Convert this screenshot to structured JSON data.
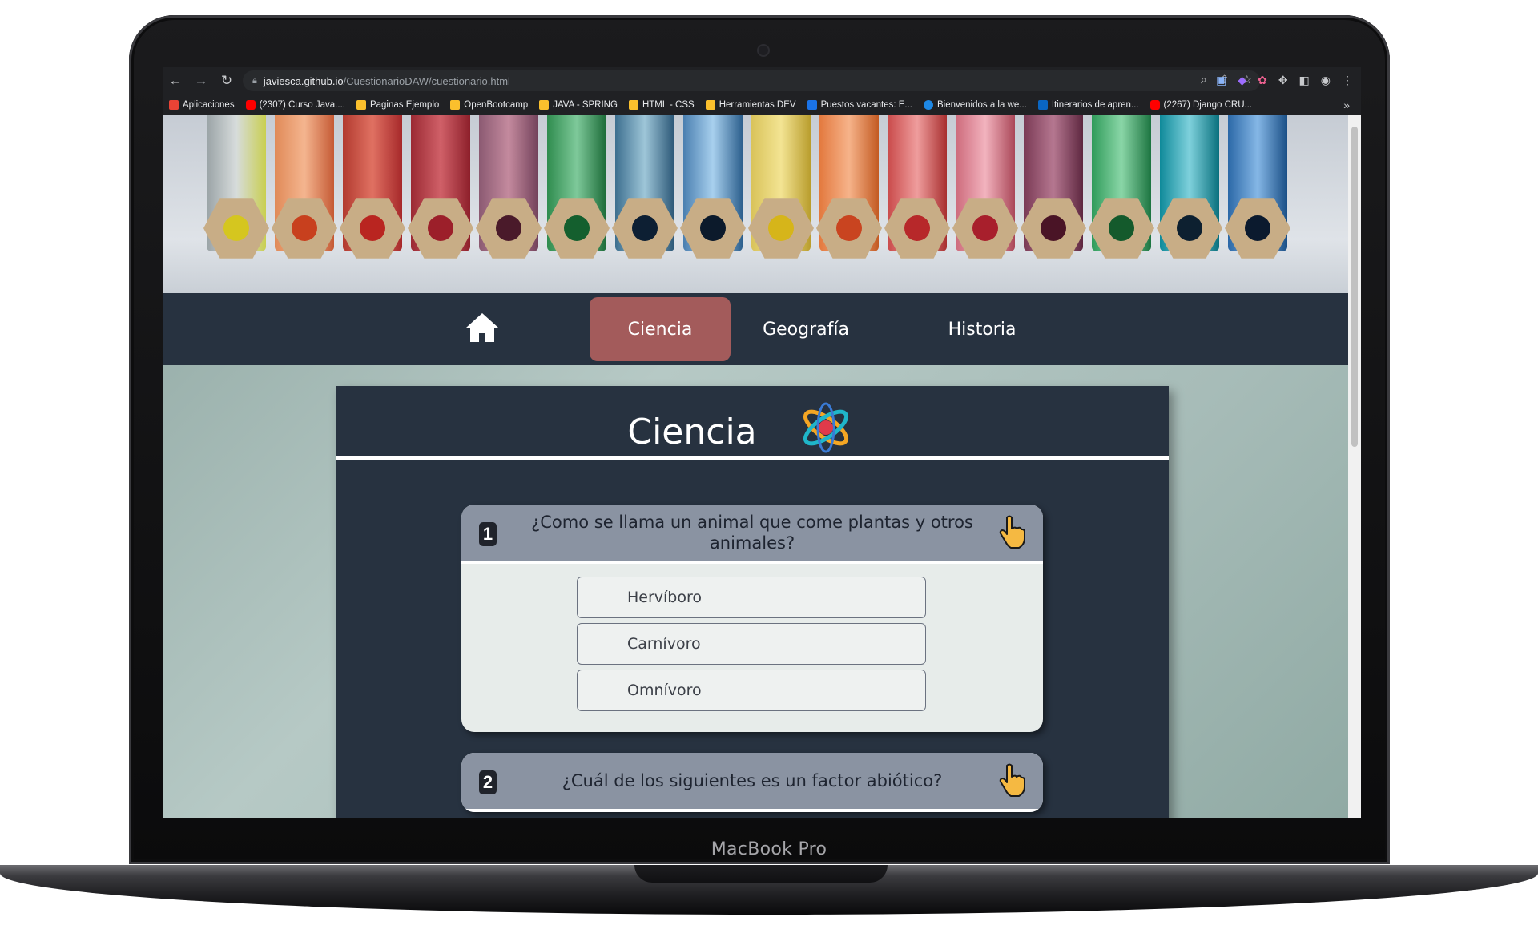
{
  "browser": {
    "url_host": "javiesca.github.io",
    "url_path": "/CuestionarioDAW/cuestionario.html",
    "bookmarks": [
      {
        "label": "Aplicaciones",
        "color": "#ea4335"
      },
      {
        "label": "(2307) Curso Java....",
        "color": "#ff0000"
      },
      {
        "label": "Paginas Ejemplo",
        "color": "#fbc02d"
      },
      {
        "label": "OpenBootcamp",
        "color": "#fbc02d"
      },
      {
        "label": "JAVA - SPRING",
        "color": "#fbc02d"
      },
      {
        "label": "HTML - CSS",
        "color": "#fbc02d"
      },
      {
        "label": "Herramientas DEV",
        "color": "#fbc02d"
      },
      {
        "label": "Puestos vacantes: E...",
        "color": "#1a73e8"
      },
      {
        "label": "Bienvenidos a la we...",
        "color": "#1e88e5"
      },
      {
        "label": "Itinerarios de apren...",
        "color": "#0a66c2"
      },
      {
        "label": "(2267) Django CRU...",
        "color": "#ff0000"
      }
    ],
    "more": "»"
  },
  "nav": {
    "items": [
      "Ciencia",
      "Geografía",
      "Historia"
    ],
    "active": "Ciencia",
    "active_color": "#a35b5b"
  },
  "section": {
    "title": "Ciencia"
  },
  "questions": [
    {
      "number": "1",
      "text": "¿Como se llama un animal que come plantas y otros animales?",
      "answers": [
        "Hervíboro",
        "Carnívoro",
        "Omnívoro"
      ]
    },
    {
      "number": "2",
      "text": "¿Cuál de los siguientes es un factor abiótico?"
    }
  ],
  "device": {
    "label": "MacBook Pro"
  }
}
